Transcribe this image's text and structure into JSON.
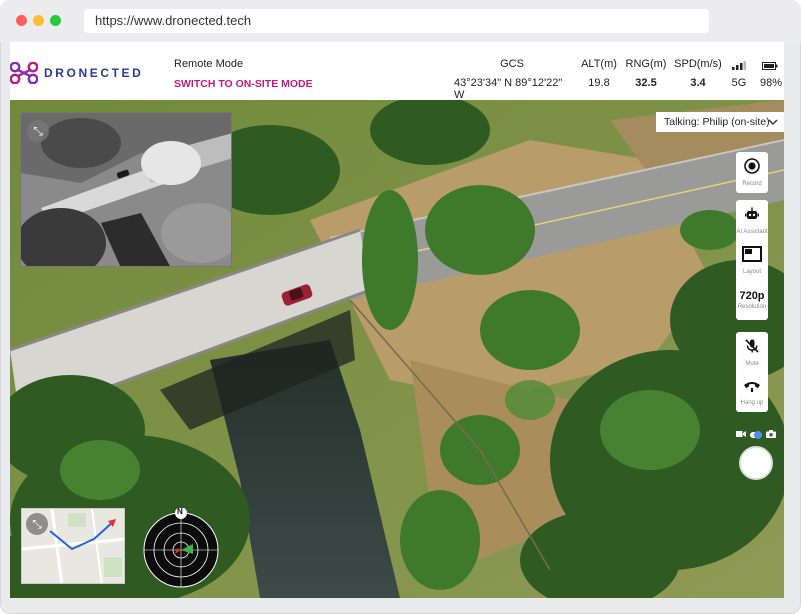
{
  "browser": {
    "url": "https://www.dronected.tech"
  },
  "brand": {
    "logo_text": "DRONECTED",
    "accent_purple": "#7b2fbe",
    "accent_magenta": "#c0197e",
    "text_blue": "#2a3a8c"
  },
  "header": {
    "mode_label": "Remote Mode",
    "switch_label": "SWITCH TO ON-SITE MODE",
    "telemetry": [
      {
        "label": "GCS",
        "value": "43°23'34\" N 89°12'22\" W",
        "bold": false
      },
      {
        "label": "ALT(m)",
        "value": "19.8",
        "bold": false
      },
      {
        "label": "RNG(m)",
        "value": "32.5",
        "bold": true
      },
      {
        "label": "SPD(m/s)",
        "value": "3.4",
        "bold": true
      }
    ],
    "network": "5G",
    "battery": "98%"
  },
  "talking": {
    "label": "Talking: Philip (on-site)"
  },
  "controls": {
    "record_label": "Record",
    "assistant_label": "AI Assistant",
    "layout_label": "Layout",
    "resolution_value": "720p",
    "resolution_label": "Resolution",
    "mute_label": "Mute",
    "hangup_label": "Hang up"
  },
  "radar": {
    "north_label": "N"
  },
  "icons": [
    "expand-icon",
    "record-icon",
    "robot-icon",
    "layout-icon",
    "mic-off-icon",
    "phone-icon",
    "video-icon",
    "camera-icon",
    "signal-icon",
    "battery-icon",
    "chevron-down-icon"
  ]
}
